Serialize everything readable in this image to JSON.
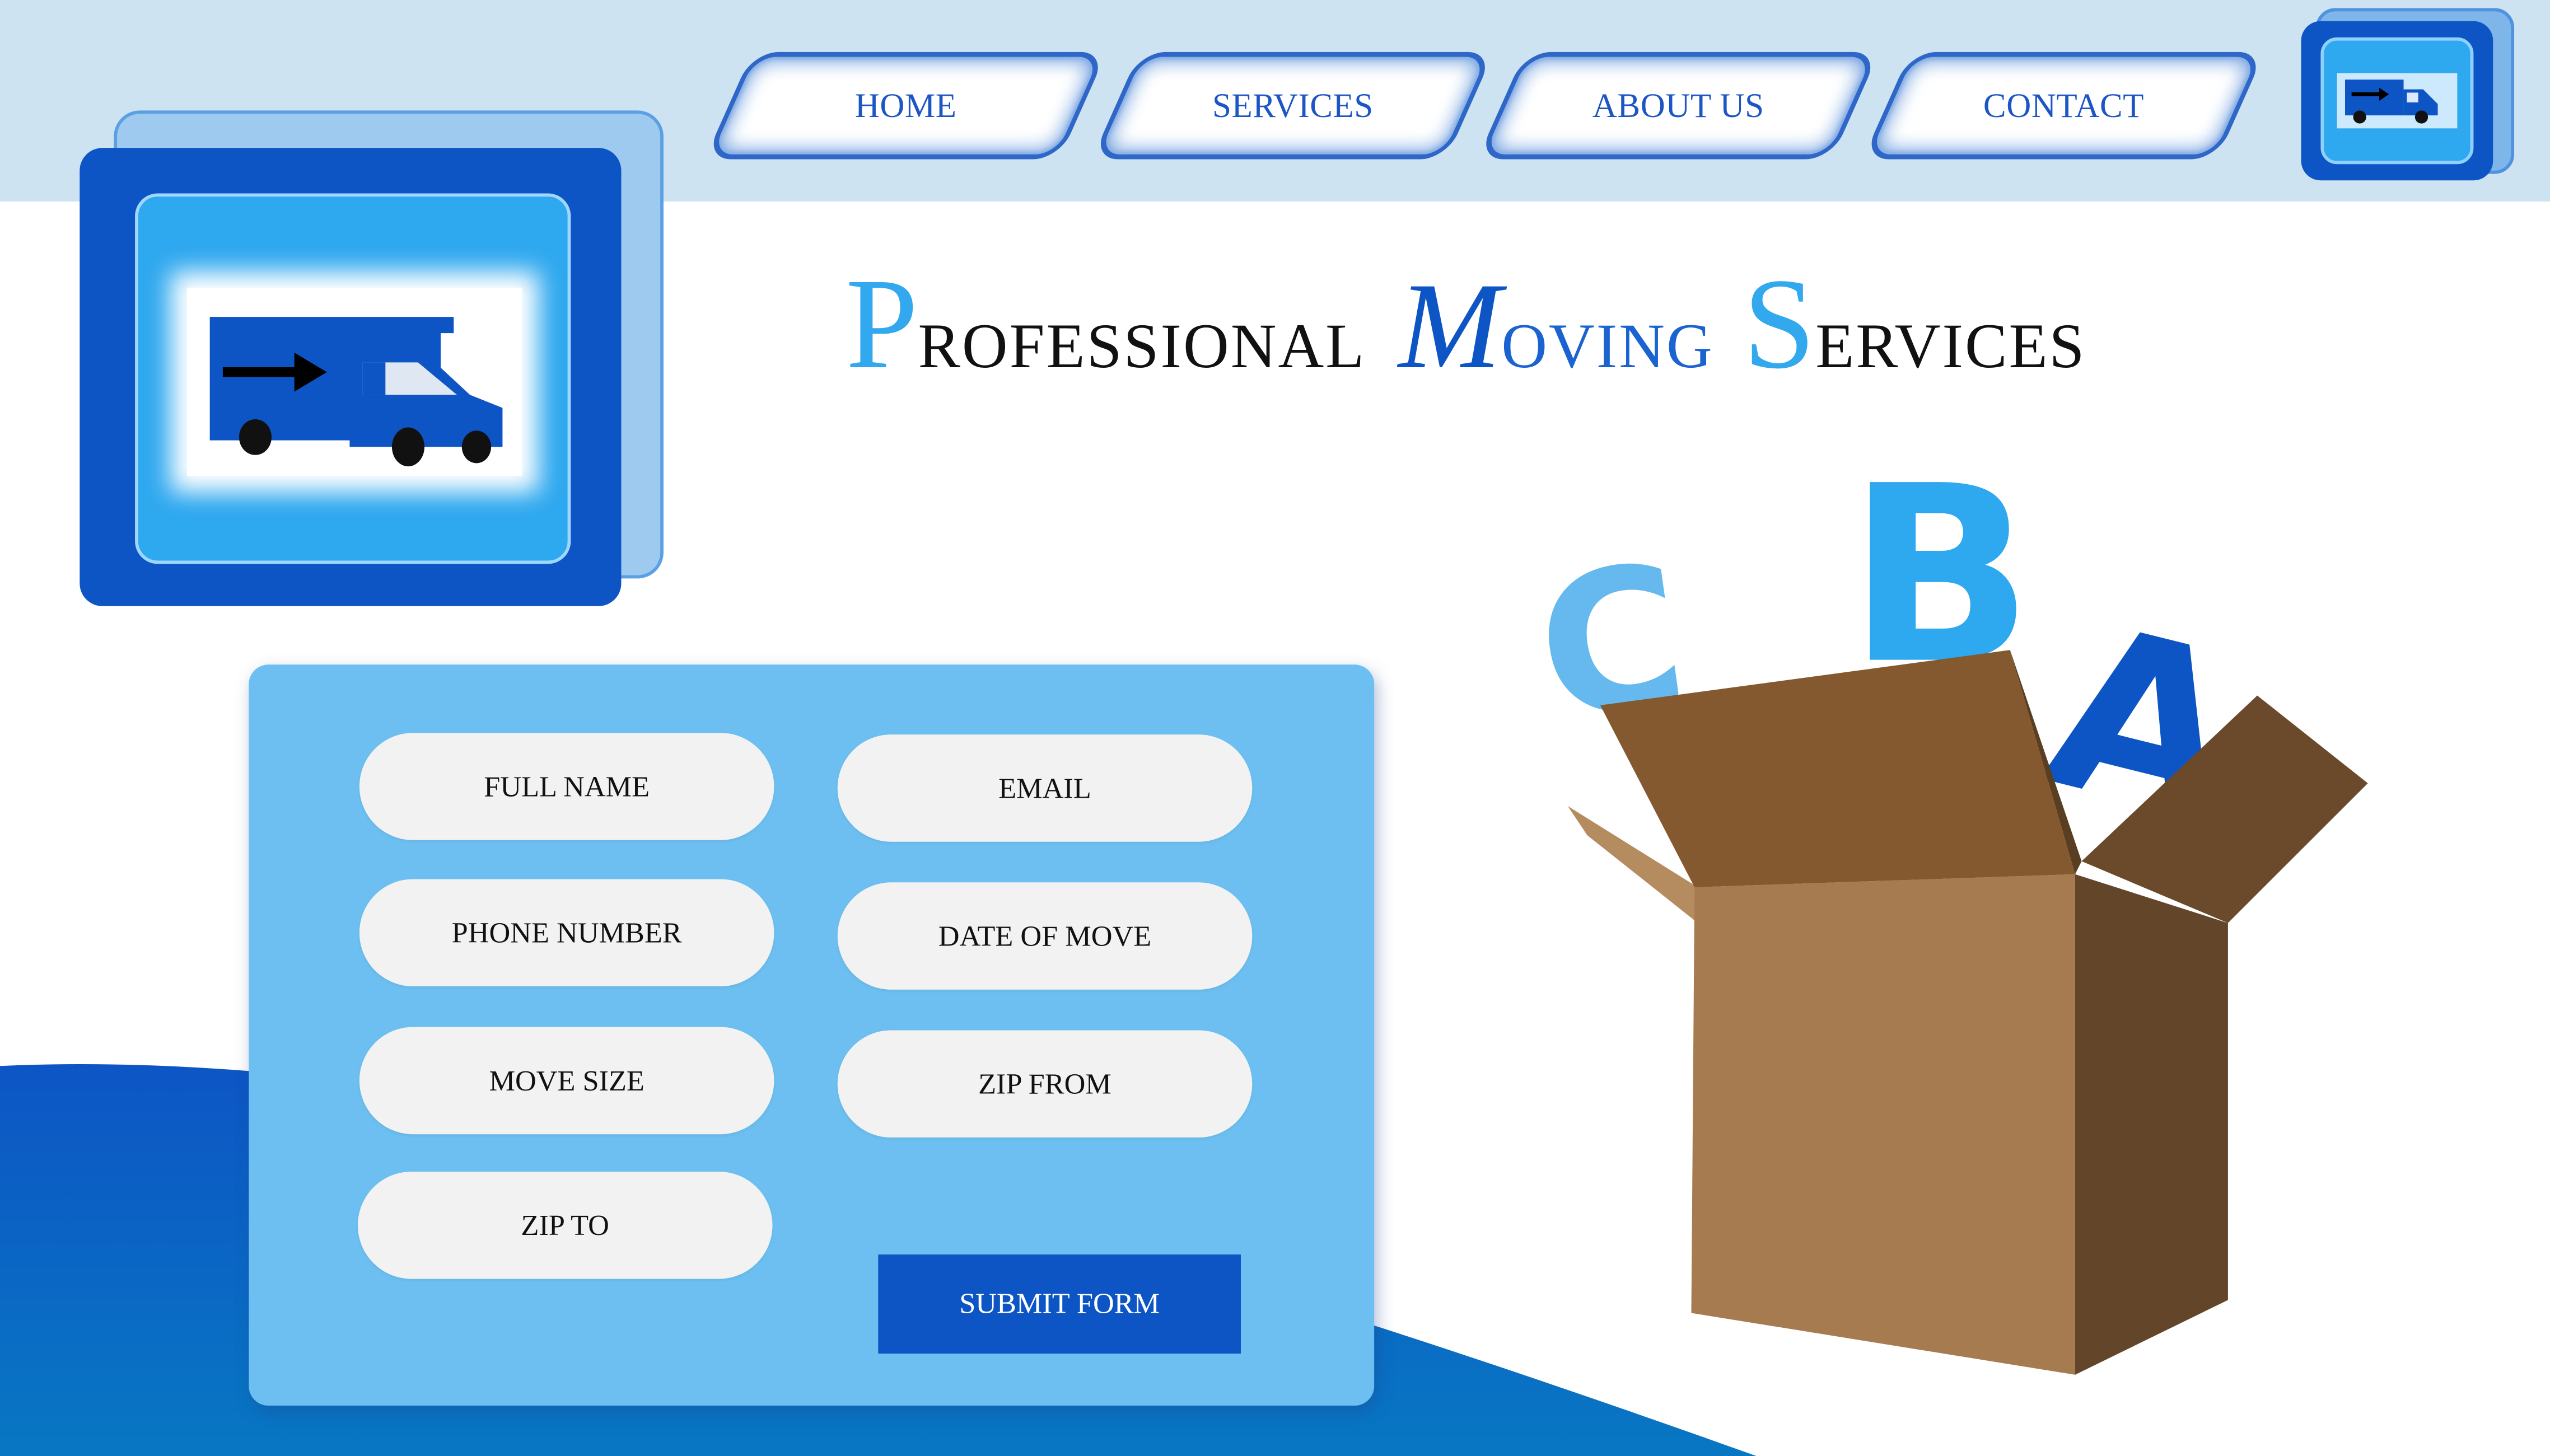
{
  "nav": {
    "items": [
      {
        "label": "HOME"
      },
      {
        "label": "SERVICES"
      },
      {
        "label": "ABOUT US"
      },
      {
        "label": "CONTACT"
      }
    ]
  },
  "logo": {
    "icon": "moving-truck-icon"
  },
  "title": {
    "word1_initial": "P",
    "word1_rest": "ROFESSIONAL",
    "word2_initial": "M",
    "word2_rest": "OVING",
    "word3_initial": "S",
    "word3_rest": "ERVICES"
  },
  "form": {
    "fields": [
      {
        "label": "FULL NAME"
      },
      {
        "label": "EMAIL"
      },
      {
        "label": "PHONE NUMBER"
      },
      {
        "label": "DATE OF MOVE"
      },
      {
        "label": "MOVE SIZE"
      },
      {
        "label": "ZIP FROM"
      },
      {
        "label": "ZIP TO"
      }
    ],
    "submit_label": "SUBMIT FORM"
  },
  "illustration": {
    "letters": [
      "C",
      "B",
      "A"
    ]
  },
  "colors": {
    "primary": "#0d55c5",
    "accent": "#2ea8ef",
    "light": "#6cbff0",
    "topbar": "#cde3f1",
    "box": "#a67c4f"
  }
}
